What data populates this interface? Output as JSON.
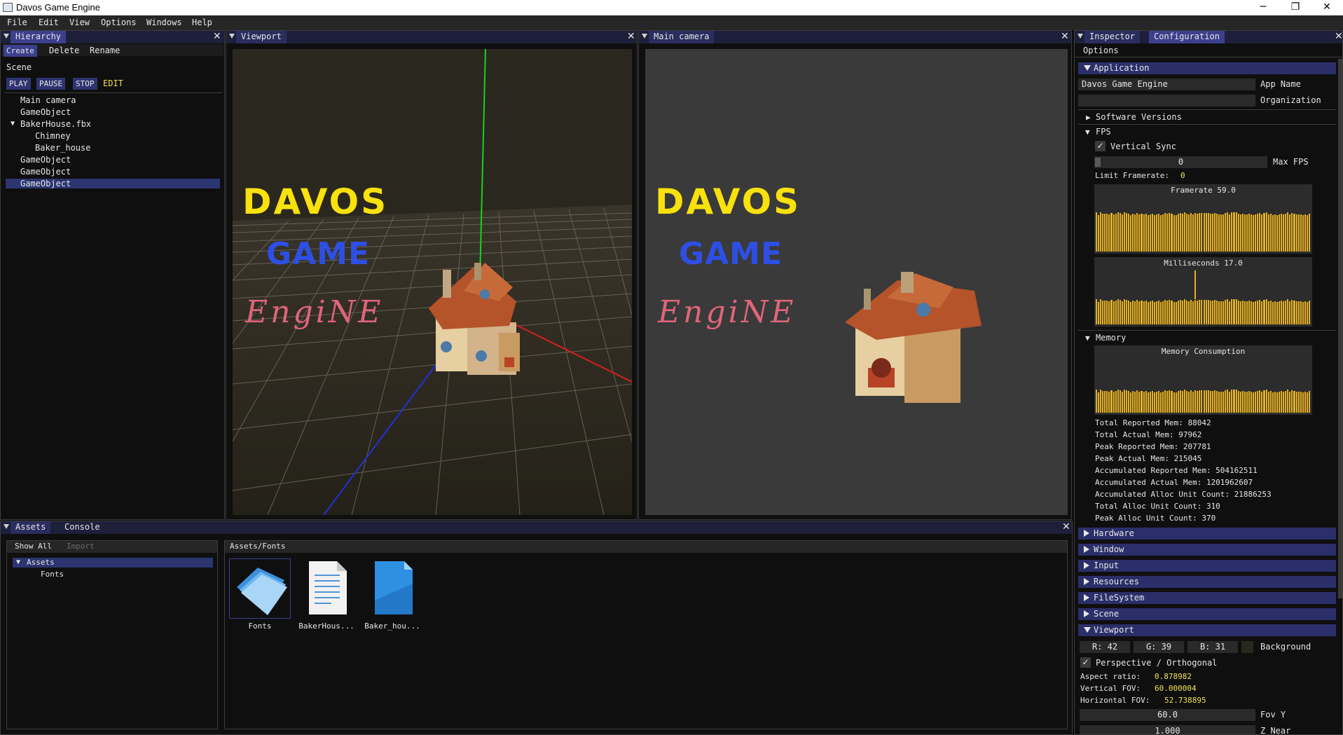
{
  "window": {
    "title": "Davos Game Engine",
    "minimize": "─",
    "maximize": "❐",
    "close": "✕"
  },
  "menu": [
    "File",
    "Edit",
    "View",
    "Options",
    "Windows",
    "Help"
  ],
  "hierarchy": {
    "tab": "Hierarchy",
    "toolbar": [
      "Create",
      "Delete",
      "Rename"
    ],
    "scene_label": "Scene",
    "controls": [
      "PLAY",
      "PAUSE",
      "STOP",
      "EDIT"
    ],
    "tree": [
      {
        "label": "Main camera",
        "depth": 0,
        "selected": false
      },
      {
        "label": "GameObject",
        "depth": 0,
        "selected": false
      },
      {
        "label": "BakerHouse.fbx",
        "depth": 0,
        "expanded": true,
        "selected": false
      },
      {
        "label": "Chimney",
        "depth": 1,
        "selected": false
      },
      {
        "label": "Baker_house",
        "depth": 1,
        "selected": false
      },
      {
        "label": "GameObject",
        "depth": 0,
        "selected": false
      },
      {
        "label": "GameObject",
        "depth": 0,
        "selected": false
      },
      {
        "label": "GameObject",
        "depth": 0,
        "selected": true
      }
    ]
  },
  "viewport": {
    "tab": "Viewport",
    "logo": {
      "line1": "DAVOS",
      "line2": "GAME",
      "line3": "EngiNE"
    }
  },
  "main_camera": {
    "tab": "Main camera",
    "logo": {
      "line1": "DAVOS",
      "line2": "GAME",
      "line3": "EngiNE"
    }
  },
  "inspector": {
    "tabs": [
      "Inspector",
      "Configuration"
    ],
    "options_label": "Options",
    "application": {
      "header": "Application",
      "app_name_value": "Davos Game Engine",
      "app_name_label": "App Name",
      "organization_value": "",
      "organization_label": "Organization",
      "software_versions": "Software Versions"
    },
    "fps": {
      "header": "FPS",
      "vsync_label": "Vertical Sync",
      "vsync_checked": "✓",
      "max_fps_value": "0",
      "max_fps_label": "Max FPS",
      "limit_label": "Limit Framerate:",
      "limit_value": "0",
      "framerate_title": "Framerate 59.0",
      "ms_title": "Milliseconds 17.0",
      "bar_color": "#e6b020"
    },
    "memory": {
      "header": "Memory",
      "plot_title": "Memory Consumption",
      "stats": [
        "Total Reported Mem: 88042",
        "Total Actual Mem: 97962",
        "Peak Reported Mem: 207781",
        "Peak Actual Mem: 215045",
        "Accumulated Reported Mem: 504162511",
        "Accumulated Actual Mem: 1201962607",
        "Accumulated Alloc Unit Count: 21886253",
        "Total Alloc Unit Count: 310",
        "Peak Alloc Unit Count: 370"
      ]
    },
    "collapsed_sections": [
      "Hardware",
      "Window",
      "Input",
      "Resources",
      "FileSystem",
      "Scene"
    ],
    "viewport_section": {
      "header": "Viewport",
      "r": "R: 42",
      "g": "G: 39",
      "b": "B: 31",
      "background_label": "Background",
      "perspective_checked": "✓",
      "perspective_label": "Perspective / Orthogonal",
      "aspect_label": "Aspect ratio:",
      "aspect_value": "0.878982",
      "vfov_label": "Vertical FOV:",
      "vfov_value": "60.000004",
      "hfov_label": "Horizontal FOV:",
      "hfov_value": "52.738895",
      "fovy_value": "60.0",
      "fovy_label": "Fov Y",
      "znear_value": "1.000",
      "znear_label": "Z Near"
    }
  },
  "assets": {
    "tabs": [
      "Assets",
      "Console"
    ],
    "toolbar": [
      "Show All",
      "Import"
    ],
    "tree_root": "Assets",
    "tree_child": "Fonts",
    "path": "Assets/Fonts",
    "files": [
      {
        "label": "Fonts",
        "icon": "folder-icon"
      },
      {
        "label": "BakerHous...",
        "icon": "document-icon"
      },
      {
        "label": "Baker_hou...",
        "icon": "file-icon"
      }
    ]
  }
}
